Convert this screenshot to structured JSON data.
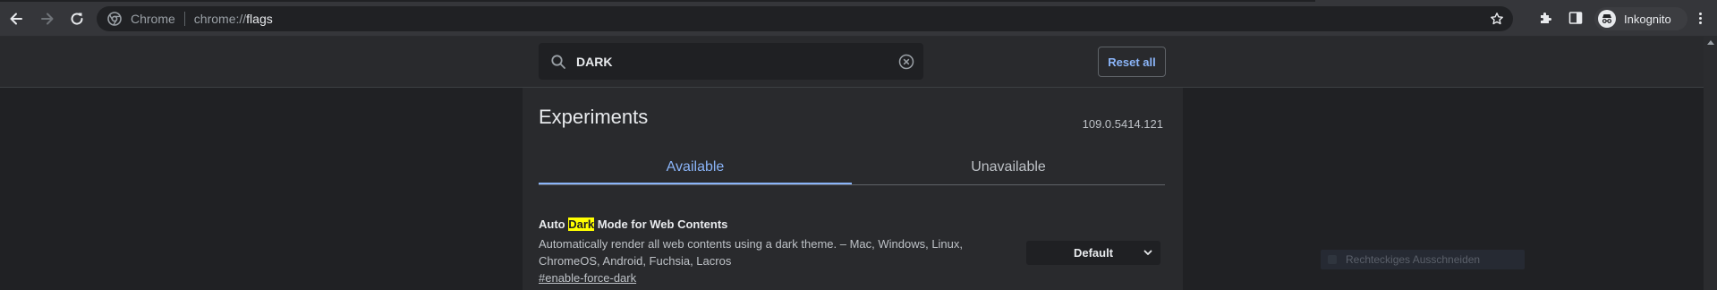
{
  "browser": {
    "omnibox": {
      "origin_label": "Chrome",
      "url_prefix": "chrome://",
      "url_host": "flags"
    },
    "profile": {
      "label": "Inkognito"
    }
  },
  "flags_page": {
    "search": {
      "value": "DARK"
    },
    "reset_all_label": "Reset all",
    "title": "Experiments",
    "version": "109.0.5414.121",
    "tabs": [
      {
        "label": "Available",
        "active": true
      },
      {
        "label": "Unavailable",
        "active": false
      }
    ],
    "experiment": {
      "title_before": "Auto ",
      "title_highlight": "Dark",
      "title_after": " Mode for Web Contents",
      "description": "Automatically render all web contents using a dark theme. – Mac, Windows, Linux, ChromeOS, Android, Fuchsia, Lacros",
      "link": "#enable-force-dark",
      "select_value": "Default"
    }
  },
  "overlay": {
    "ghost_tooltip": "Rechteckiges Ausschneiden"
  },
  "colors": {
    "accent": "#8ab4f8",
    "highlight": "#ffff00",
    "background": "#202124"
  }
}
